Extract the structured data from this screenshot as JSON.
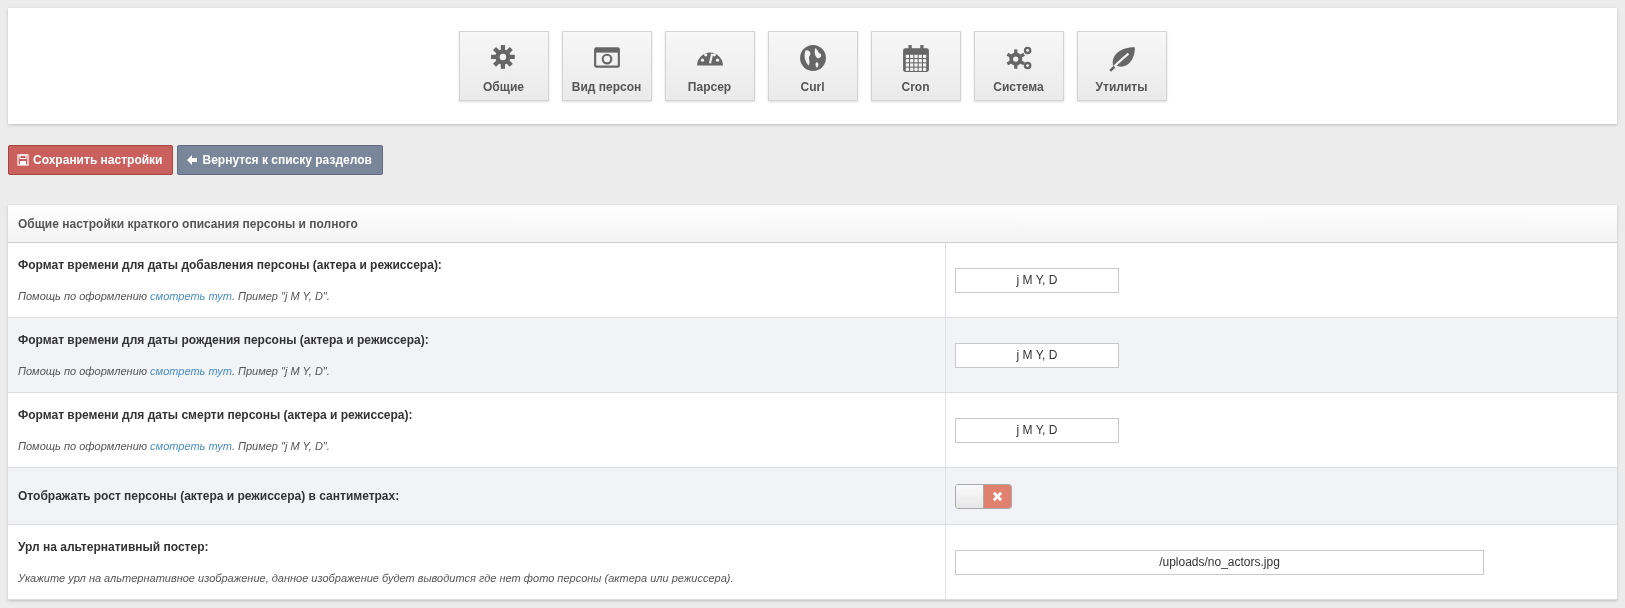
{
  "nav_tiles": [
    {
      "label": "Общие"
    },
    {
      "label": "Вид персон"
    },
    {
      "label": "Парсер"
    },
    {
      "label": "Curl"
    },
    {
      "label": "Cron"
    },
    {
      "label": "Система"
    },
    {
      "label": "Утилиты"
    }
  ],
  "buttons": [
    {
      "label": "Сохранить настройки",
      "kind": "save"
    },
    {
      "label": "Вернутся к списку разделов",
      "kind": "back"
    }
  ],
  "panel": {
    "title": "Общие настройки краткого описания персоны и полного",
    "rows": [
      {
        "kind": "input",
        "label": "Формат времени для даты добавления персоны (актера и режиссера):",
        "help_before": "Помощь по оформлению ",
        "help_link": "смотреть тут",
        "help_after": ". Пример \"j M Y, D\".",
        "value": "j M Y, D"
      },
      {
        "kind": "input",
        "label": "Формат времени для даты рождения персоны (актера и режиссера):",
        "help_before": "Помощь по оформлению ",
        "help_link": "смотреть тут",
        "help_after": ". Пример \"j M Y, D\".",
        "value": "j M Y, D"
      },
      {
        "kind": "input",
        "label": "Формат времени для даты смерти персоны (актера и режиссера):",
        "help_before": "Помощь по оформлению ",
        "help_link": "смотреть тут",
        "help_after": ". Пример \"j M Y, D\".",
        "value": "j M Y, D"
      },
      {
        "kind": "toggle",
        "label": "Отображать рост персоны (актера и режиссера) в сантиметрах:",
        "on": false
      },
      {
        "kind": "wide_input",
        "label": "Урл на альтернативный постер:",
        "help_before": "Укажите урл на альтернативное изображение, данное изображение будет выводится где нет фото персоны (актера или режиссера).",
        "value": "/uploads/no_actors.jpg"
      }
    ]
  }
}
